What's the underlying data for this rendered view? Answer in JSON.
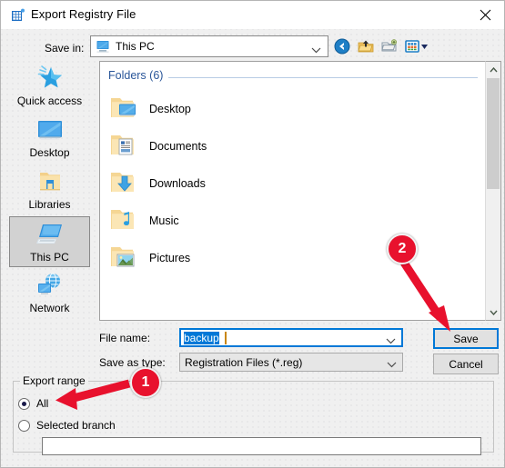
{
  "window": {
    "title": "Export Registry File",
    "icon": "registry-editor-icon",
    "close_label": "✕"
  },
  "toolbar": {
    "save_in_label": "Save in:",
    "save_in_value": "This PC",
    "save_in_icon": "this-pc-icon",
    "buttons": [
      {
        "name": "back-button",
        "icon": "back-arrow-icon"
      },
      {
        "name": "up-one-level-button",
        "icon": "up-folder-icon"
      },
      {
        "name": "new-folder-button",
        "icon": "new-folder-icon"
      },
      {
        "name": "views-button",
        "icon": "views-grid-icon"
      }
    ]
  },
  "places_bar": {
    "items": [
      {
        "label": "Quick access",
        "icon": "star-icon",
        "selected": false
      },
      {
        "label": "Desktop",
        "icon": "desktop-monitor-icon",
        "selected": false
      },
      {
        "label": "Libraries",
        "icon": "libraries-folder-icon",
        "selected": false
      },
      {
        "label": "This PC",
        "icon": "this-pc-icon",
        "selected": true
      },
      {
        "label": "Network",
        "icon": "network-globe-icon",
        "selected": false
      }
    ]
  },
  "file_list": {
    "group_header": "Folders (6)",
    "folders": [
      {
        "name": "Desktop",
        "icon": "folder-desktop-icon"
      },
      {
        "name": "Documents",
        "icon": "folder-documents-icon"
      },
      {
        "name": "Downloads",
        "icon": "folder-downloads-icon"
      },
      {
        "name": "Music",
        "icon": "folder-music-icon"
      },
      {
        "name": "Pictures",
        "icon": "folder-pictures-icon"
      }
    ]
  },
  "form": {
    "file_name_label": "File name:",
    "file_name_value": "backup",
    "save_as_type_label": "Save as type:",
    "save_as_type_value": "Registration Files (*.reg)",
    "save_button": "Save",
    "cancel_button": "Cancel"
  },
  "export_range": {
    "group_label": "Export range",
    "options": [
      {
        "label": "All",
        "selected": true
      },
      {
        "label": "Selected branch",
        "selected": false
      }
    ],
    "branch_value": ""
  },
  "annotations": {
    "badges": [
      {
        "label": "1",
        "target": "all-radio"
      },
      {
        "label": "2",
        "target": "save-button"
      }
    ],
    "color": "#e8112d"
  }
}
